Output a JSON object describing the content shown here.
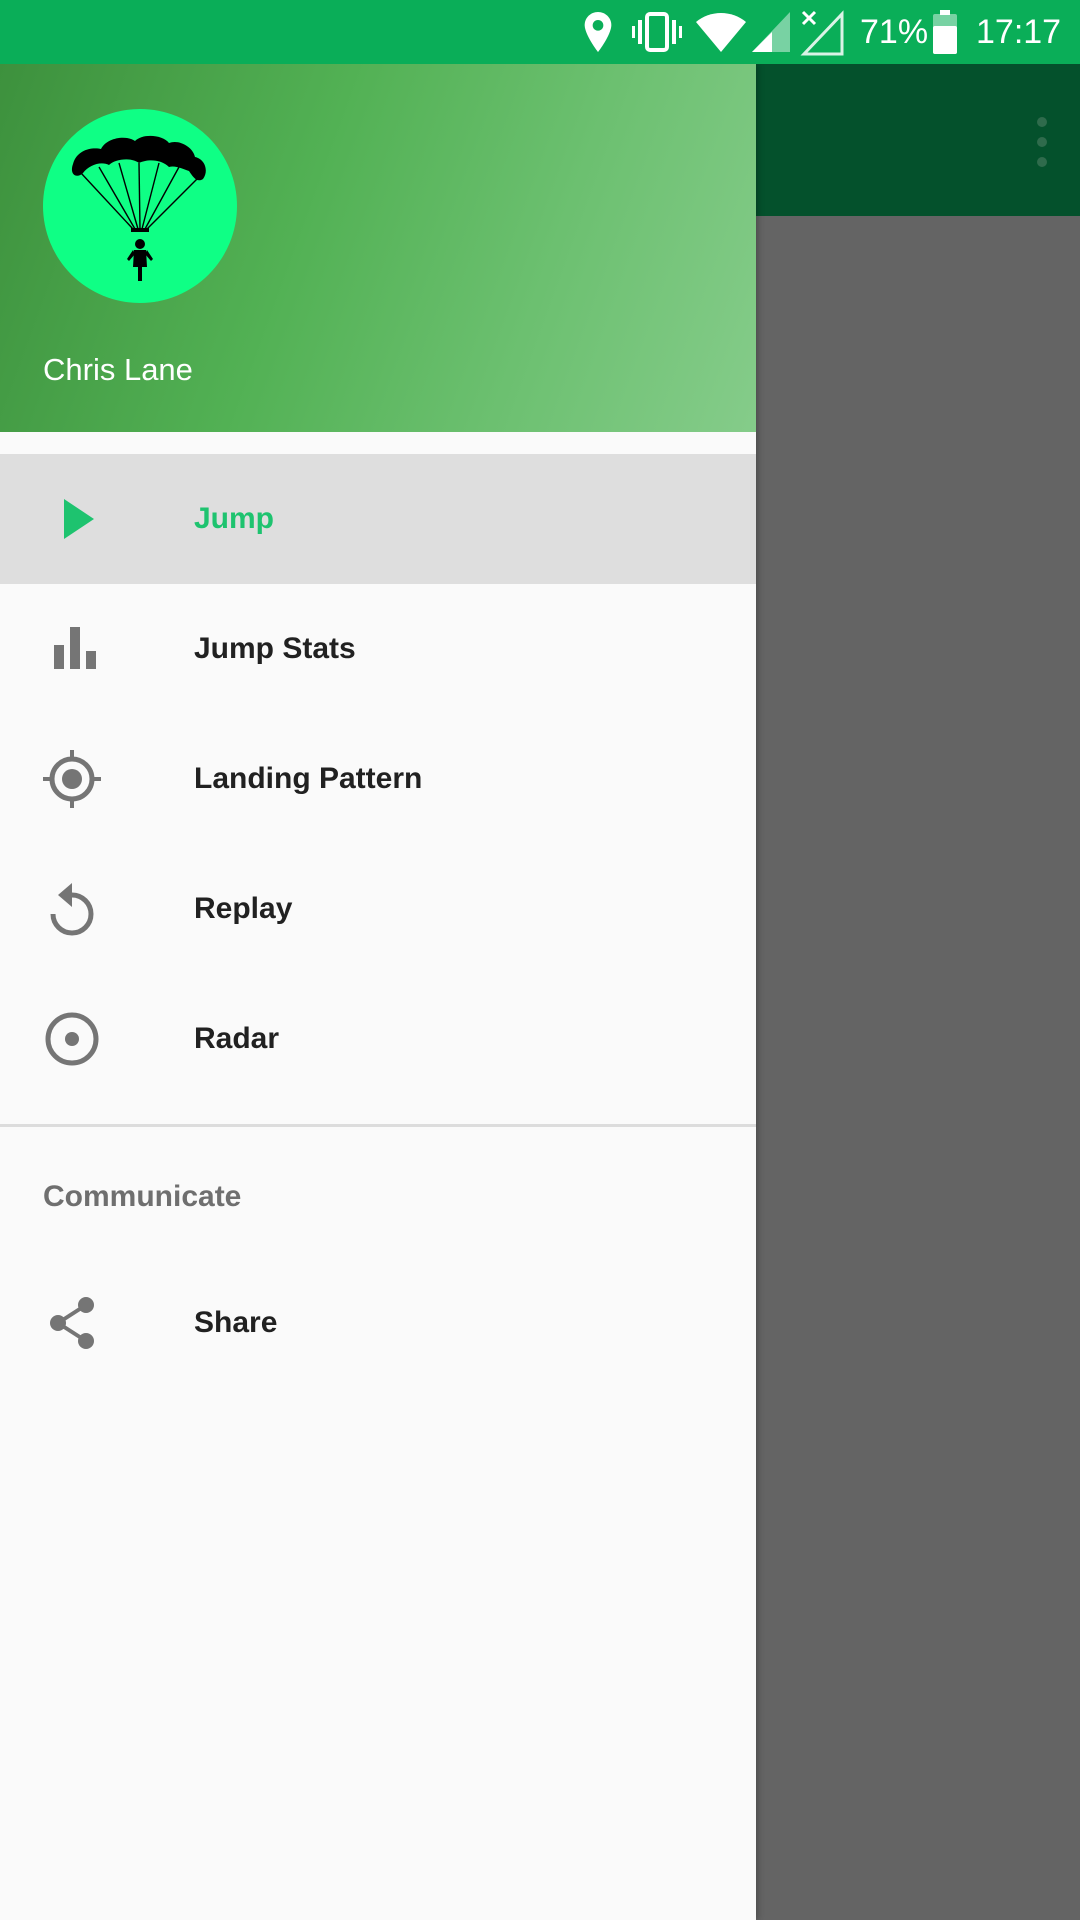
{
  "status_bar": {
    "battery_percent": "71%",
    "time": "17:17",
    "icons": [
      "location-icon",
      "vibrate-icon",
      "wifi-icon",
      "signal-icon",
      "no-signal-icon",
      "battery-icon"
    ]
  },
  "colors": {
    "status_bar": "#0aae58",
    "app_bar": "#04512c",
    "accent": "#1ec36f",
    "avatar_bg": "#0fff85",
    "scrim": "#646464"
  },
  "drawer": {
    "user_name": "Chris Lane",
    "avatar_icon": "parachutist-icon",
    "items": [
      {
        "label": "Jump",
        "icon": "play-icon",
        "active": true
      },
      {
        "label": "Jump Stats",
        "icon": "bar-chart-icon",
        "active": false
      },
      {
        "label": "Landing Pattern",
        "icon": "crosshair-icon",
        "active": false
      },
      {
        "label": "Replay",
        "icon": "replay-icon",
        "active": false
      },
      {
        "label": "Radar",
        "icon": "radar-icon",
        "active": false
      }
    ],
    "section_title": "Communicate",
    "share": {
      "label": "Share",
      "icon": "share-icon"
    }
  },
  "app_bar": {
    "overflow_icon": "more-vert-icon"
  }
}
